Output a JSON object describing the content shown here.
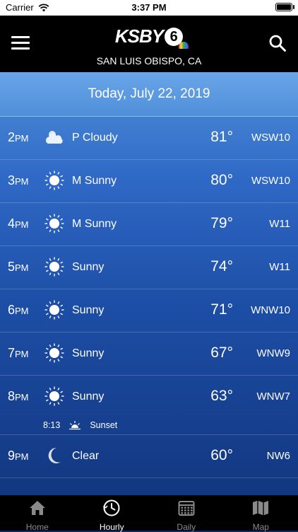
{
  "status_bar": {
    "carrier": "Carrier",
    "time": "3:37 PM"
  },
  "header": {
    "logo": "KSBY",
    "logo_number": "6",
    "location": "SAN LUIS OBISPO, CA"
  },
  "date": "Today, July 22, 2019",
  "rows": [
    {
      "hour": "2",
      "ampm": "PM",
      "icon": "partly-cloudy-icon",
      "condition": "P Cloudy",
      "temp": "81°",
      "wind": "WSW10"
    },
    {
      "hour": "3",
      "ampm": "PM",
      "icon": "sun-icon",
      "condition": "M Sunny",
      "temp": "80°",
      "wind": "WSW10"
    },
    {
      "hour": "4",
      "ampm": "PM",
      "icon": "sun-icon",
      "condition": "M Sunny",
      "temp": "79°",
      "wind": "W11"
    },
    {
      "hour": "5",
      "ampm": "PM",
      "icon": "sun-icon",
      "condition": "Sunny",
      "temp": "74°",
      "wind": "W11"
    },
    {
      "hour": "6",
      "ampm": "PM",
      "icon": "sun-icon",
      "condition": "Sunny",
      "temp": "71°",
      "wind": "WNW10"
    },
    {
      "hour": "7",
      "ampm": "PM",
      "icon": "sun-icon",
      "condition": "Sunny",
      "temp": "67°",
      "wind": "WNW9"
    },
    {
      "hour": "8",
      "ampm": "PM",
      "icon": "sun-icon",
      "condition": "Sunny",
      "temp": "63°",
      "wind": "WNW7"
    },
    {
      "hour": "9",
      "ampm": "PM",
      "icon": "moon-icon",
      "condition": "Clear",
      "temp": "60°",
      "wind": "NW6"
    }
  ],
  "sunset": {
    "time": "8:13",
    "label": "Sunset"
  },
  "tabs": [
    {
      "label": "Home",
      "icon": "home-icon",
      "active": false
    },
    {
      "label": "Hourly",
      "icon": "clock-icon",
      "active": true
    },
    {
      "label": "Daily",
      "icon": "calendar-icon",
      "active": false
    },
    {
      "label": "Map",
      "icon": "map-icon",
      "active": false
    }
  ],
  "colors": {
    "header_bg": "#000000",
    "content_top": "#4f8fd9",
    "content_bottom": "#123780",
    "tab_inactive": "#8a8a8a"
  }
}
